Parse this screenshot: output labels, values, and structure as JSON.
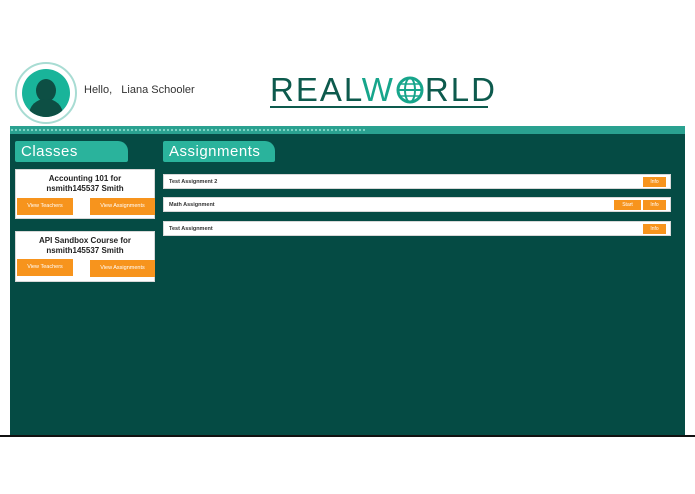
{
  "header": {
    "greeting": "Hello,   Liana Schooler",
    "logo": {
      "part1": "REAL",
      "part2": "W",
      "part3": "RLD"
    }
  },
  "classes": {
    "title": "Classes",
    "items": [
      {
        "name": "Accounting 101 for nsmith145537 Smith",
        "teachers_label": "View Teachers",
        "assignments_label": "View Assignments"
      },
      {
        "name": "API Sandbox Course for nsmith145537 Smith",
        "teachers_label": "View Teachers",
        "assignments_label": "View Assignments"
      }
    ]
  },
  "assignments": {
    "title": "Assignments",
    "items": [
      {
        "name": "Test Assignment 2",
        "info_label": "Info"
      },
      {
        "name": "Math Assignment",
        "start_label": "Start",
        "info_label": "Info"
      },
      {
        "name": "Test Assignment",
        "info_label": "Info"
      }
    ]
  },
  "colors": {
    "primary": "#054b44",
    "accent": "#2ab39c",
    "button": "#f7941d"
  }
}
